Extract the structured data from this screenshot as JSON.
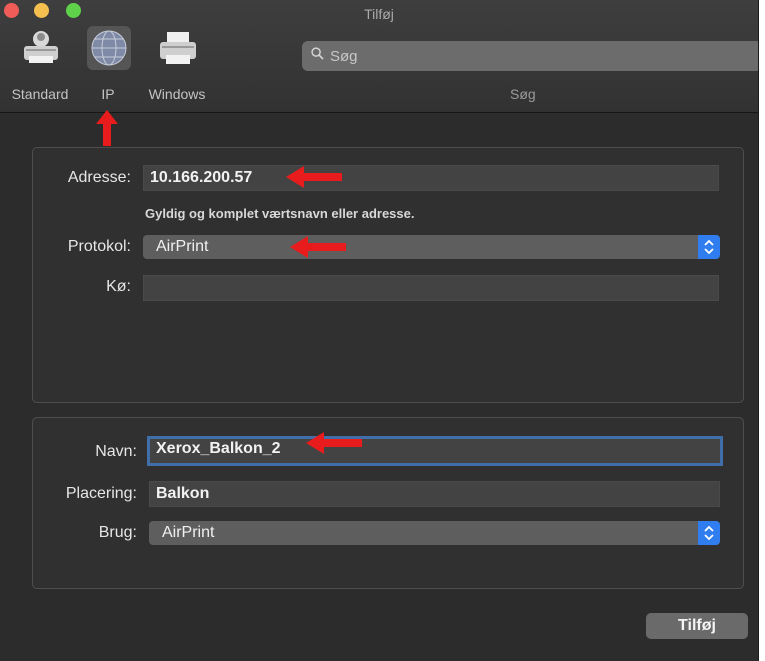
{
  "window": {
    "title": "Tilføj"
  },
  "toolbar": {
    "buttons": [
      {
        "id": "standard",
        "label": "Standard",
        "icon": "printer-icon"
      },
      {
        "id": "ip",
        "label": "IP",
        "icon": "globe-network-icon",
        "selected": true
      },
      {
        "id": "windows",
        "label": "Windows",
        "icon": "printer-icon"
      }
    ],
    "search": {
      "placeholder": "Søg",
      "caption": "Søg"
    }
  },
  "printer_group": {
    "address_label": "Adresse:",
    "address_value": "10.166.200.57",
    "address_hint": "Gyldig og komplet værtsnavn eller adresse.",
    "protocol_label": "Protokol:",
    "protocol_value": "AirPrint",
    "queue_label": "Kø:",
    "queue_value": ""
  },
  "details_group": {
    "name_label": "Navn:",
    "name_value": "Xerox_Balkon_2",
    "location_label": "Placering:",
    "location_value": "Balkon",
    "use_label": "Brug:",
    "use_value": "AirPrint"
  },
  "footer": {
    "add_button": "Tilføj"
  },
  "colors": {
    "accent": "#2f7dee",
    "annotation_arrow": "#e81c1c",
    "focus_ring": "#3f6ea8"
  }
}
